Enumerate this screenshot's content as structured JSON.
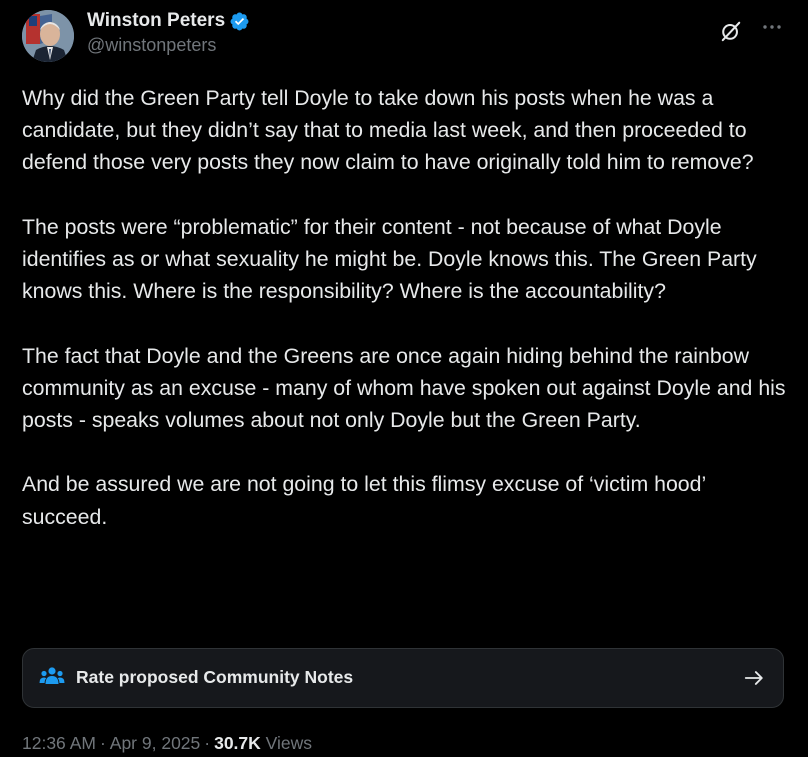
{
  "author": {
    "display_name": "Winston Peters",
    "handle": "@winstonpeters"
  },
  "tweet": {
    "paragraphs": [
      "Why did the Green Party tell Doyle to take down his posts when he was a candidate, but they didn’t say that to media last week, and then proceeded to defend those very posts they now claim to have originally told him to remove?",
      "The posts were “problematic” for their content - not because of what Doyle identifies as or what sexuality he might be. Doyle knows this. The Green Party knows this. Where is the responsibility? Where is the accountability?",
      "The fact that Doyle and the Greens are once again hiding behind the rainbow community as an excuse - many of whom have spoken out against Doyle and his posts - speaks volumes about not only Doyle but the Green Party.",
      "And be assured we are not going to let this flimsy excuse of ‘victim hood’ succeed."
    ]
  },
  "community_notes": {
    "label": "Rate proposed Community Notes",
    "icon": "people-icon"
  },
  "meta": {
    "time": "12:36 AM",
    "date": "Apr 9, 2025",
    "separator": "·",
    "views_count": "30.7K",
    "views_label": "Views"
  },
  "icons": {
    "verified": "verified-badge-icon",
    "grok": "grok-icon",
    "more": "more-icon",
    "arrow": "arrow-right-icon"
  },
  "colors": {
    "background": "#000000",
    "text_primary": "#e7e9ea",
    "text_secondary": "#71767b",
    "verified_blue": "#1d9bf0",
    "notes_icon_blue": "#1d9bf0",
    "card_border": "#2f3336"
  }
}
